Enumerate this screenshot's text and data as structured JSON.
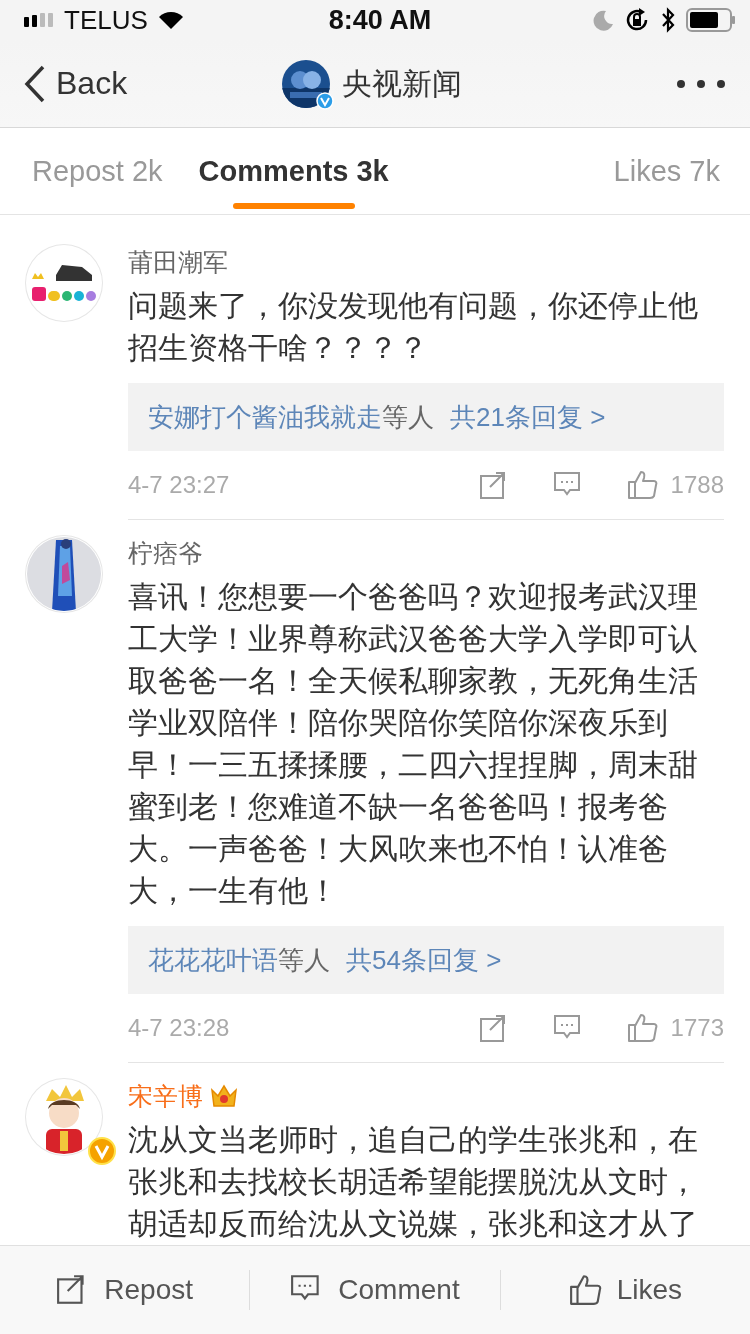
{
  "status_bar": {
    "carrier": "TELUS",
    "time": "8:40 AM"
  },
  "nav": {
    "back": "Back",
    "title": "央视新闻",
    "verified": true
  },
  "tabs": [
    {
      "label": "Repost 2k",
      "selected": false
    },
    {
      "label": "Comments 3k",
      "selected": true
    },
    {
      "label": "Likes 7k",
      "selected": false
    }
  ],
  "comments": [
    {
      "user": "莆田潮军",
      "vip": false,
      "verified": false,
      "text": "问题来了，你没发现他有问题，你还停止他招生资格干啥？？？？",
      "replies": {
        "names": "安娜打个酱油我就走",
        "suffix": "等人",
        "count": "共21条回复 >"
      },
      "time": "4-7 23:27",
      "likes": "1788"
    },
    {
      "user": "柠痞爷",
      "vip": false,
      "verified": false,
      "text": "喜讯！您想要一个爸爸吗？欢迎报考武汉理工大学！业界尊称武汉爸爸大学入学即可认取爸爸一名！全天候私聊家教，无死角生活学业双陪伴！陪你哭陪你笑陪你深夜乐到早！一三五揉揉腰，二四六捏捏脚，周末甜蜜到老！您难道不缺一名爸爸吗！报考爸大。一声爸爸！大风吹来也不怕！认准爸大，一生有他！",
      "replies": {
        "names": "花花花叶语",
        "suffix": "等人",
        "count": "共54条回复 >"
      },
      "time": "4-7 23:28",
      "likes": "1773"
    },
    {
      "user": "宋辛博",
      "vip": true,
      "verified": true,
      "text": "沈从文当老师时，追自己的学生张兆和，在张兆和去找校长胡适希望能摆脱沈从文时，胡适却反而给沈从文说媒，张兆和这才从了"
    }
  ],
  "toolbar": [
    {
      "kind": "repost",
      "label": "Repost"
    },
    {
      "kind": "comment",
      "label": "Comment"
    },
    {
      "kind": "like",
      "label": "Likes"
    }
  ]
}
